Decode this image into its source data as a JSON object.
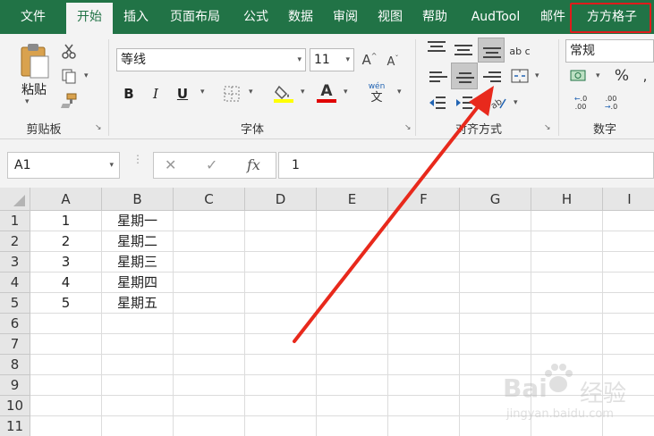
{
  "tabs": [
    {
      "label": "文件",
      "active": false
    },
    {
      "label": "开始",
      "active": true
    },
    {
      "label": "插入",
      "active": false
    },
    {
      "label": "页面布局",
      "active": false
    },
    {
      "label": "公式",
      "active": false
    },
    {
      "label": "数据",
      "active": false
    },
    {
      "label": "审阅",
      "active": false
    },
    {
      "label": "视图",
      "active": false
    },
    {
      "label": "帮助",
      "active": false
    },
    {
      "label": "AudTool",
      "active": false
    },
    {
      "label": "邮件",
      "active": false
    },
    {
      "label": "方方格子",
      "active": false,
      "highlighted": true
    }
  ],
  "clipboard": {
    "paste_label": "粘贴",
    "group_label": "剪贴板"
  },
  "font": {
    "font_name": "等线",
    "font_size": "11",
    "bold": "B",
    "italic": "I",
    "underline": "U",
    "wen_label": "wén",
    "wen_char": "文",
    "group_label": "字体",
    "fill_color": "#ffff00",
    "font_color": "#e00000"
  },
  "alignment": {
    "wrap_icon_text": "ab c",
    "group_label": "对齐方式"
  },
  "number": {
    "format_value": "常规",
    "percent": "%",
    "group_label": "数字"
  },
  "formula_bar": {
    "name_box": "A1",
    "cancel": "✕",
    "confirm": "✓",
    "fx": "fx",
    "content": "1"
  },
  "sheet": {
    "columns": [
      "A",
      "B",
      "C",
      "D",
      "E",
      "F",
      "G",
      "H",
      "I"
    ],
    "rows": [
      "1",
      "2",
      "3",
      "4",
      "5",
      "6",
      "7",
      "8",
      "9",
      "10",
      "11"
    ],
    "col_a": [
      "1",
      "2",
      "3",
      "4",
      "5",
      "",
      "",
      "",
      "",
      "",
      ""
    ],
    "col_b": [
      "星期一",
      "星期二",
      "星期三",
      "星期四",
      "星期五",
      "",
      "",
      "",
      "",
      "",
      ""
    ]
  },
  "watermark": {
    "brand": "Bai",
    "brand2": "经验",
    "url": "jingyan.baidu.com"
  },
  "colors": {
    "ribbon_green": "#217346",
    "highlight_red": "#e01b1b",
    "arrow_red": "#e8291c"
  }
}
